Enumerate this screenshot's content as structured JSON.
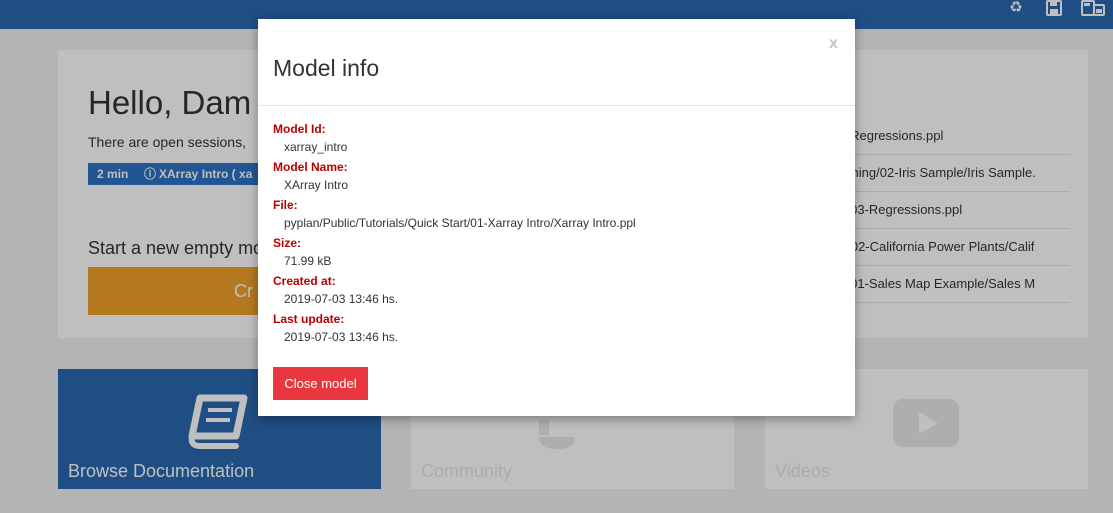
{
  "topbar": {
    "icons": [
      "recycle-icon",
      "save-icon",
      "save-as-icon"
    ]
  },
  "background": {
    "greeting": "Hello, Dam",
    "open_sessions_text": "There are open sessions,",
    "session": {
      "time": "2 min",
      "info_icon": "info-icon",
      "name": "XArray Intro ( xa"
    },
    "start_new_text": "Start a new empty mo",
    "create_button_label": "Cr",
    "recent_models": [
      "s/Regressions.ppl",
      "arning/02-Iris Sample/Iris Sample.",
      "s/03-Regressions.ppl",
      "n/02-California Power Plants/Calif",
      "s/01-Sales Map Example/Sales M"
    ],
    "tiles": [
      {
        "label": "Browse Documentation",
        "icon": "book-icon"
      },
      {
        "label": "Community",
        "icon": "community-icon"
      },
      {
        "label": "Videos",
        "icon": "play-icon"
      }
    ]
  },
  "modal": {
    "title": "Model info",
    "close_glyph": "x",
    "fields": [
      {
        "label": "Model Id:",
        "value": "xarray_intro"
      },
      {
        "label": "Model Name:",
        "value": "XArray Intro"
      },
      {
        "label": "File:",
        "value": "pyplan/Public/Tutorials/Quick Start/01-Xarray Intro/Xarray Intro.ppl"
      },
      {
        "label": "Size:",
        "value": "71.99 kB"
      },
      {
        "label": "Created at:",
        "value": "2019-07-03 13:46 hs."
      },
      {
        "label": "Last update:",
        "value": "2019-07-03 13:46 hs."
      }
    ],
    "close_button_label": "Close model"
  },
  "colors": {
    "topbar": "#2a69b0",
    "label_red": "#b80000",
    "close_button": "#e8373f",
    "create_button": "#f0a02a"
  }
}
